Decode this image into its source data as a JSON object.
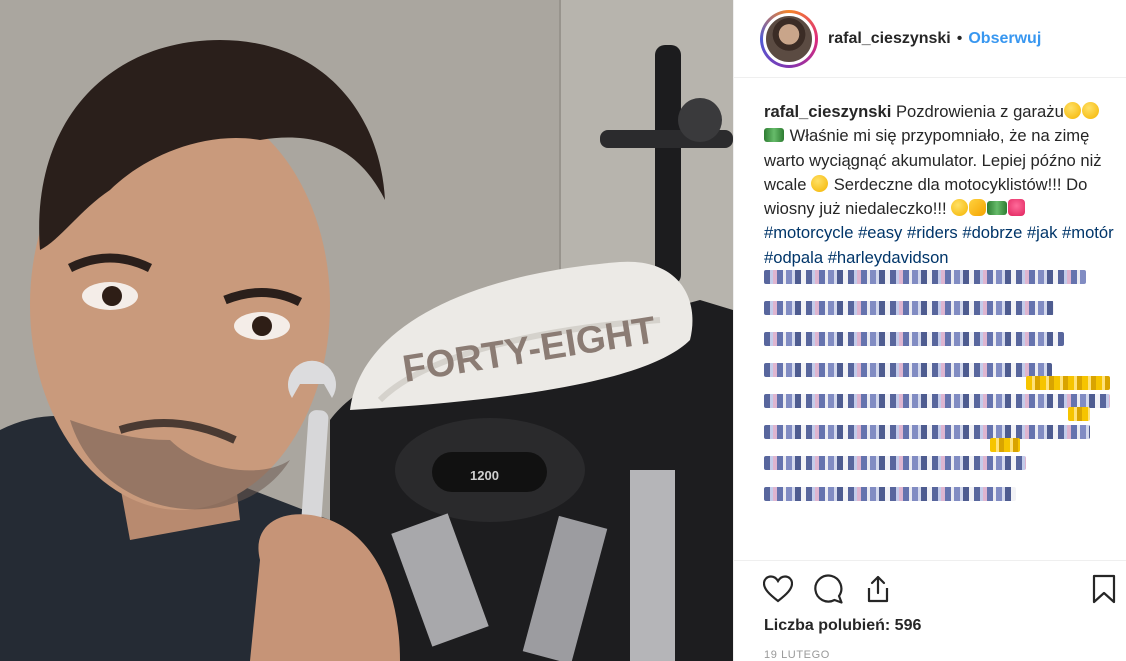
{
  "photo": {
    "tank_text": "FORTY-EIGHT",
    "engine_text": "1200"
  },
  "header": {
    "username": "rafal_cieszynski",
    "separator": "•",
    "follow_label": "Obserwuj"
  },
  "caption": {
    "username": "rafal_cieszynski",
    "text_1": "Pozdrowienia z garażu",
    "text_2": "Właśnie mi się przypomniało, że na zimę warto wyciągnąć akumulator. Lepiej późno niż wcale",
    "text_3": "Serdeczne dla motocyklistów!!! Do wiosny już niedaleczko!!!",
    "hashtags": [
      "#motorcycle",
      "#easy",
      "#riders",
      "#dobrze",
      "#jak",
      "#motór",
      "#odpala",
      "#harleydavidson"
    ]
  },
  "actions": {
    "like_icon": "heart-icon",
    "comment_icon": "comment-icon",
    "share_icon": "share-icon",
    "save_icon": "bookmark-icon",
    "likes_text": "Liczba polubień: 596",
    "date": "19 LUTEGO"
  },
  "colors": {
    "link": "#3897f0",
    "hashtag": "#003569",
    "text": "#262626",
    "muted": "#999999"
  }
}
